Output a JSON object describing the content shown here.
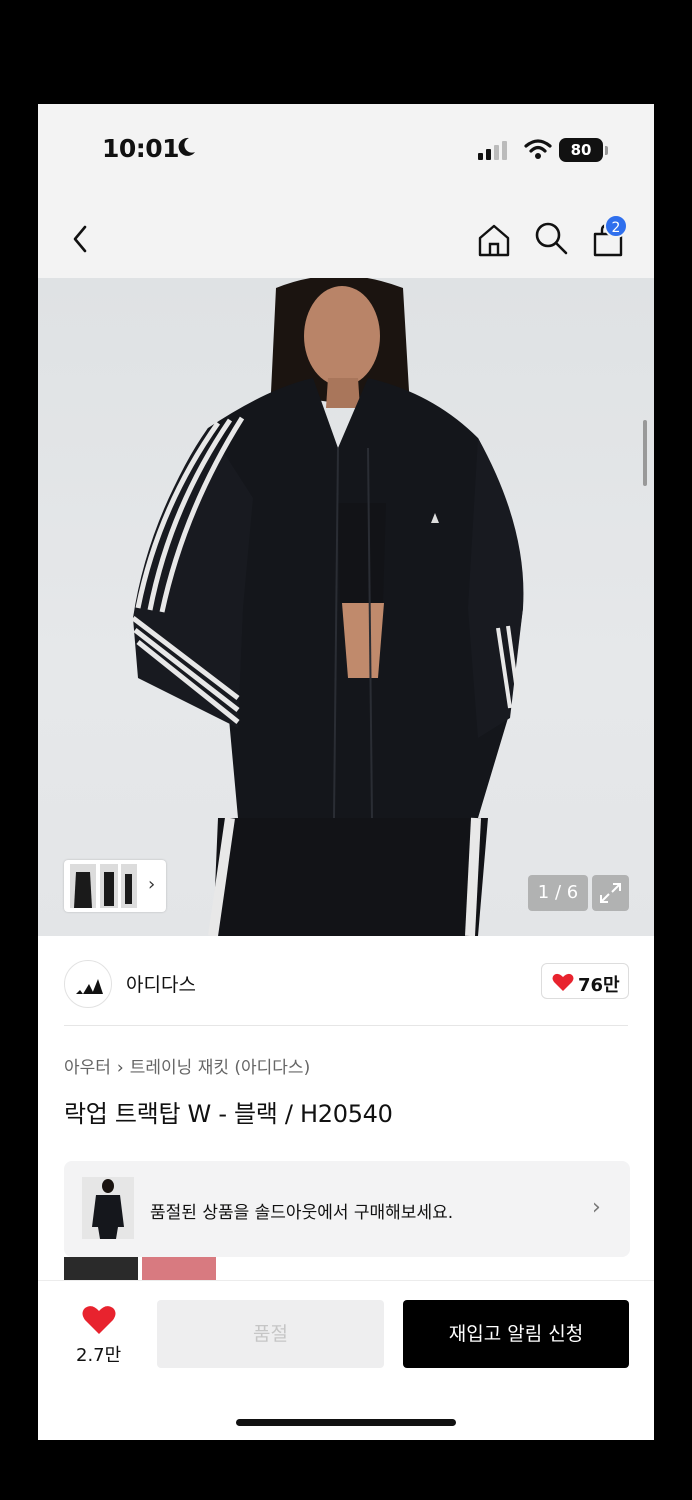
{
  "status_bar": {
    "time": "10:01",
    "battery": "80"
  },
  "nav": {
    "cart_badge": "2"
  },
  "gallery": {
    "page_counter": "1 / 6"
  },
  "brand": {
    "name": "아디다스",
    "likes": "76만"
  },
  "product": {
    "breadcrumb": [
      "아우터",
      "트레이닝 재킷 (아디다스)"
    ],
    "title": "락업 트랙탑 W - 블랙 / H20540"
  },
  "soldout_banner": {
    "text": "품절된 상품을 솔드아웃에서 구매해보세요."
  },
  "bottom_bar": {
    "favorite_count": "2.7만",
    "soldout_label": "품절",
    "restock_label": "재입고 알림 신청"
  },
  "colors": {
    "accent_red": "#e8232e",
    "badge_blue": "#2f6fed",
    "primary_black": "#000000"
  }
}
